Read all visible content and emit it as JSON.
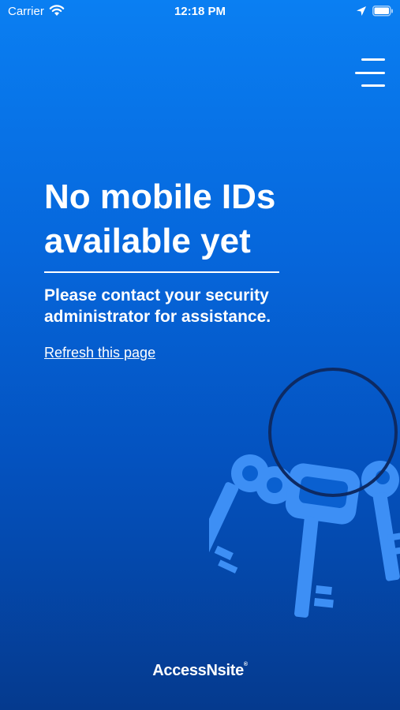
{
  "status_bar": {
    "carrier": "Carrier",
    "time": "12:18 PM",
    "icons": [
      "wifi-icon",
      "location-arrow-icon",
      "battery-icon"
    ]
  },
  "header": {
    "menu_icon": "hamburger-menu-icon"
  },
  "main": {
    "headline": "No mobile IDs available yet",
    "message": "Please contact your security administrator for assistance.",
    "refresh_link": "Refresh this page"
  },
  "illustration": {
    "icon": "keys-on-ring-icon",
    "ring_color": "#0d2a63",
    "key_color": "#3d8ff5"
  },
  "footer": {
    "brand_name": "AccessNsite",
    "trademark": "®"
  }
}
